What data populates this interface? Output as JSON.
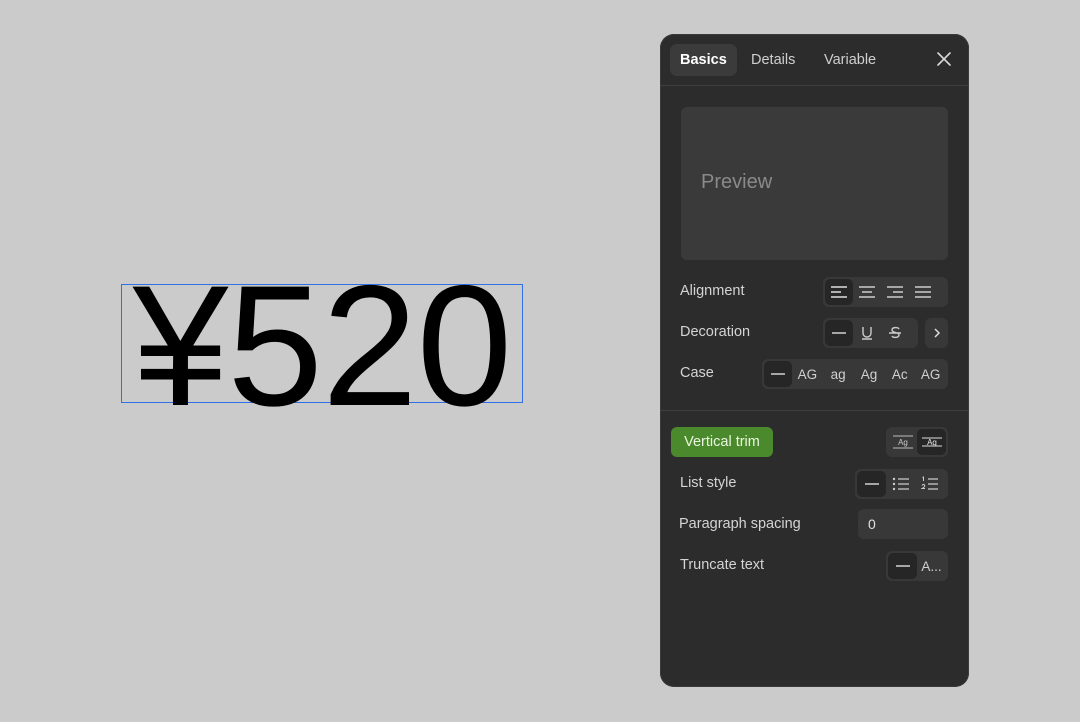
{
  "canvas": {
    "text": "¥520"
  },
  "panel": {
    "tabs": [
      {
        "label": "Basics"
      },
      {
        "label": "Details"
      },
      {
        "label": "Variable"
      }
    ],
    "preview": "Preview",
    "alignment": {
      "label": "Alignment"
    },
    "decoration": {
      "label": "Decoration"
    },
    "case": {
      "label": "Case",
      "options": [
        "AG",
        "ag",
        "Ag",
        "Ac",
        "AG"
      ]
    },
    "vertical_trim": {
      "label": "Vertical trim",
      "icon_text": "Ag"
    },
    "list_style": {
      "label": "List style"
    },
    "paragraph_spacing": {
      "label": "Paragraph spacing",
      "value": "0"
    },
    "truncate": {
      "label": "Truncate text",
      "option": "A..."
    }
  },
  "colors": {
    "panel_bg": "#2c2c2c",
    "accent_green": "#4a8a2c",
    "selection_blue": "#2f6fe8"
  }
}
